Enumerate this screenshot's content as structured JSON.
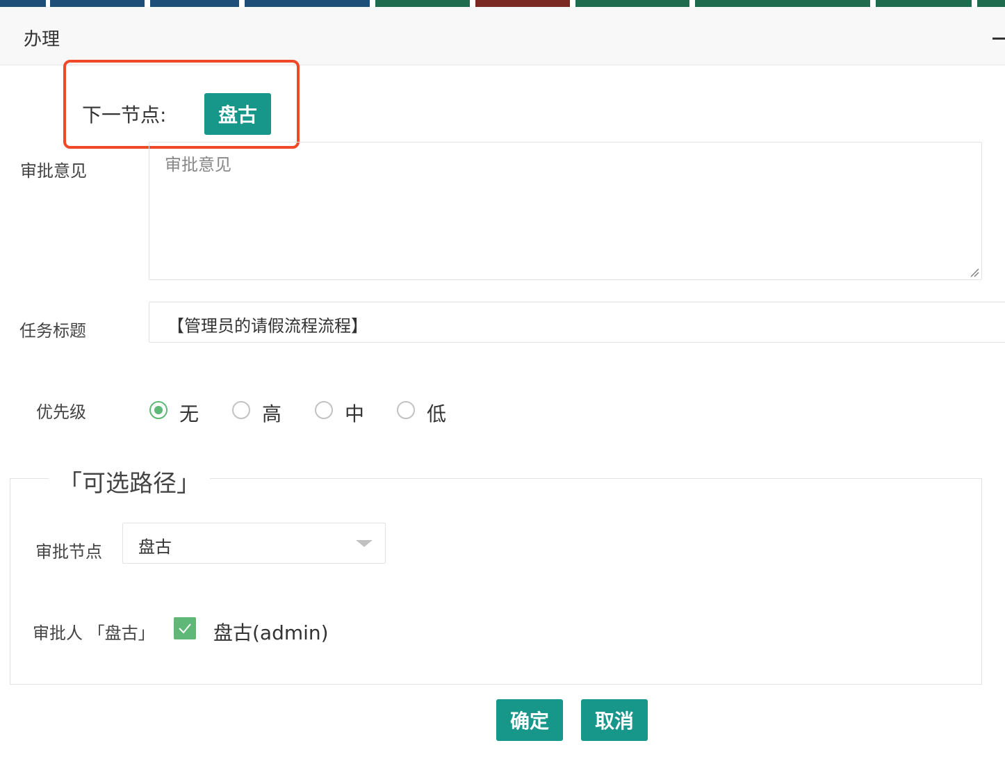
{
  "topbar": {
    "colors": [
      "#1f4e79",
      "#1f4e79",
      "#1f4e79",
      "#1f4e79",
      "#1e6b4e",
      "#7a2a22",
      "#1e6b4e",
      "#1e6b4e",
      "#1e6b4e",
      "#1e6b4e"
    ]
  },
  "dialog": {
    "title": "办理"
  },
  "next_node": {
    "label": "下一节点:",
    "button": "盘古"
  },
  "form": {
    "opinion_label": "审批意见",
    "opinion_placeholder": "审批意见",
    "task_title_label": "任务标题",
    "task_title_value": "【管理员的请假流程流程】",
    "priority_label": "优先级",
    "priority_options": [
      "无",
      "高",
      "中",
      "低"
    ],
    "priority_selected": "无"
  },
  "route": {
    "legend": "「可选路径」",
    "node_label": "审批节点",
    "node_selected": "盘古",
    "approver_label": "审批人 「盘古」",
    "approver_option": "盘古(admin)",
    "approver_checked": true
  },
  "actions": {
    "confirm": "确定",
    "cancel": "取消"
  },
  "colors": {
    "primary": "#17968a",
    "checked": "#5fb878",
    "highlight": "#f0492a"
  }
}
